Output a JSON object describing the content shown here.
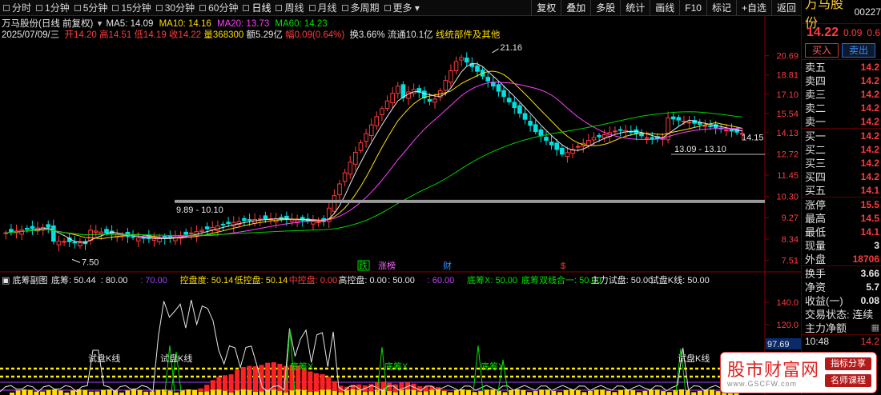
{
  "toolbar": {
    "timeframes": [
      {
        "label": "分时",
        "active": false
      },
      {
        "label": "1分钟",
        "active": false
      },
      {
        "label": "5分钟",
        "active": false
      },
      {
        "label": "15分钟",
        "active": false
      },
      {
        "label": "30分钟",
        "active": false
      },
      {
        "label": "60分钟",
        "active": false
      },
      {
        "label": "日线",
        "active": true
      },
      {
        "label": "周线",
        "active": false
      },
      {
        "label": "月线",
        "active": false
      },
      {
        "label": "多周期",
        "active": false
      },
      {
        "label": "更多",
        "active": false
      }
    ],
    "right_buttons": [
      "复权",
      "叠加",
      "多股",
      "统计",
      "画线",
      "F10",
      "标记",
      "+自选",
      "返回"
    ]
  },
  "header": {
    "title": "万马股份(日线 前复权)",
    "ma5": "MA5: 14.09",
    "ma10": "MA10: 14.16",
    "ma20": "MA20: 13.73",
    "ma60": "MA60: 14.23",
    "date": "2025/07/09/三",
    "open": "开14.20",
    "high": "高14.51",
    "low": "低14.19",
    "close": "收14.22",
    "vol": "量368300",
    "amount": "额5.29亿",
    "amp": "幅0.09(0.64%)",
    "turnover": "换3.66%",
    "float": "流通10.1亿",
    "extra": "线统部件及其他"
  },
  "price_axis": [
    "20.69",
    "18.81",
    "17.10",
    "15.54",
    "14.13",
    "12.72",
    "11.45",
    "10.30",
    "9.27",
    "8.34",
    "7.51"
  ],
  "price_marks": {
    "current": "14.15",
    "high": "21.16",
    "low": "7.50",
    "band_low": "9.89 - 10.10",
    "band_right": "13.09 - 13.10"
  },
  "events": [
    {
      "label": "跌",
      "color": "#00e000"
    },
    {
      "label": "涨榜",
      "color": "#ff60ff"
    },
    {
      "label": "财",
      "color": "#3c8cff"
    },
    {
      "label": "$",
      "color": "#ff3b3b"
    }
  ],
  "indicator": {
    "name": "底筹副图",
    "items": [
      {
        "text": "底筹: 50.44",
        "color": "#e6e6e6"
      },
      {
        "text": ": 80.00",
        "color": "#e6e6e6"
      },
      {
        "text": ": 70.00",
        "color": "#a040ff"
      },
      {
        "text": "控盘度: 50.14",
        "color": "#ffdd00"
      },
      {
        "text": "低控盘: 50.14",
        "color": "#ffdd00"
      },
      {
        "text": "中控盘: 0.00",
        "color": "#ff3b3b"
      },
      {
        "text": "高控盘: 0.00",
        "color": "#e6e6e6"
      },
      {
        "text": ": 50.00",
        "color": "#e6e6e6"
      },
      {
        "text": ": 60.00",
        "color": "#c040ff"
      },
      {
        "text": "底筹X: 50.00",
        "color": "#00e000"
      },
      {
        "text": "底筹双线合一: 50.00",
        "color": "#00e000"
      },
      {
        "text": "主力试盘: 50.00",
        "color": "#e6e6e6"
      },
      {
        "text": "试盘K线: 50.00",
        "color": "#e6e6e6"
      }
    ],
    "axis": [
      "140.0",
      "120.0"
    ],
    "current": "97.69",
    "labels": [
      "试盘K线",
      "试盘K线",
      "底筹X",
      "底筹X",
      "底筹X",
      "试盘K线"
    ]
  },
  "panel": {
    "name": "万马股份",
    "code": "00227",
    "price": "14.22",
    "change": "0.09",
    "change2": "0.6",
    "buy_label": "买入",
    "sell_label": "卖出",
    "asks": [
      {
        "label": "卖五",
        "value": "14.2"
      },
      {
        "label": "卖四",
        "value": "14.2"
      },
      {
        "label": "卖三",
        "value": "14.2"
      },
      {
        "label": "卖二",
        "value": "14.2"
      },
      {
        "label": "卖一",
        "value": "14.2"
      }
    ],
    "bids": [
      {
        "label": "买一",
        "value": "14.2"
      },
      {
        "label": "买二",
        "value": "14.2"
      },
      {
        "label": "买三",
        "value": "14.2"
      },
      {
        "label": "买四",
        "value": "14.2"
      },
      {
        "label": "买五",
        "value": "14.1"
      }
    ],
    "stats": [
      {
        "label": "涨停",
        "value": "15.5",
        "cls": ""
      },
      {
        "label": "最高",
        "value": "14.5",
        "cls": ""
      },
      {
        "label": "最低",
        "value": "14.1",
        "cls": ""
      },
      {
        "label": "现量",
        "value": "3",
        "cls": "w"
      },
      {
        "label": "外盘",
        "value": "18706",
        "cls": ""
      }
    ],
    "stats2": [
      {
        "label": "换手",
        "value": "3.66",
        "cls": "w"
      },
      {
        "label": "净资",
        "value": "5.7",
        "cls": "w"
      },
      {
        "label": "收益(一)",
        "value": "0.08",
        "cls": "w"
      }
    ],
    "trade_state": "交易状态: 连续",
    "main_net": "主力净额",
    "time": "10:48",
    "time_val": "14.2"
  },
  "watermark": {
    "title": "股市财富网",
    "url": "www.GSCFW.com",
    "tag1": "指标分享",
    "tag2": "名师课程"
  }
}
